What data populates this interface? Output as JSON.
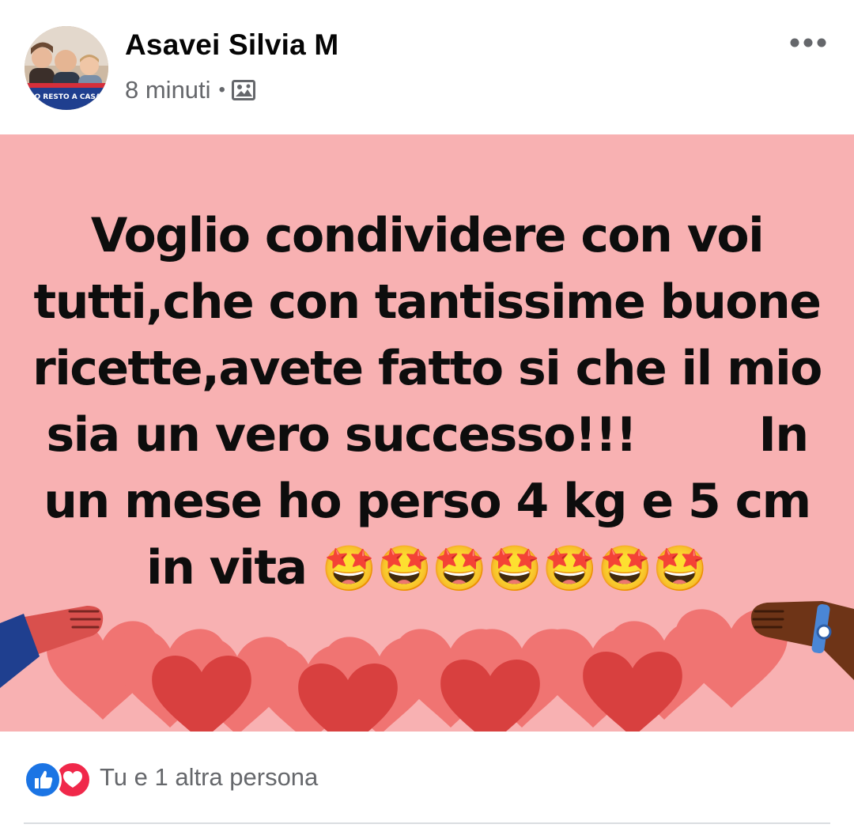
{
  "post": {
    "author": {
      "name": "Asavei Silvia M"
    },
    "timestamp": "8 minuti",
    "separator": "•",
    "audience_icon": "public-photo-icon",
    "more_icon": "more-options-icon",
    "avatar_badge": "IO RESTO A CASA",
    "content": {
      "text": "Voglio condividere con voi tutti,che con tantissime buone ricette,avete fatto si che il mio sia un vero successo!!!        In un mese ho perso 4 kg e 5 cm in vita ",
      "emoji": "🤩🤩🤩🤩🤩🤩🤩",
      "background_color": "#f8b1b2",
      "decoration": "hearts-and-hands"
    },
    "reactions": {
      "icons": [
        "like-icon",
        "love-icon"
      ],
      "summary": "Tu e 1 altra persona"
    }
  },
  "colors": {
    "like": "#1b74e4",
    "love": "#f0284a",
    "meta_text": "#65676b",
    "name_text": "#050505"
  }
}
